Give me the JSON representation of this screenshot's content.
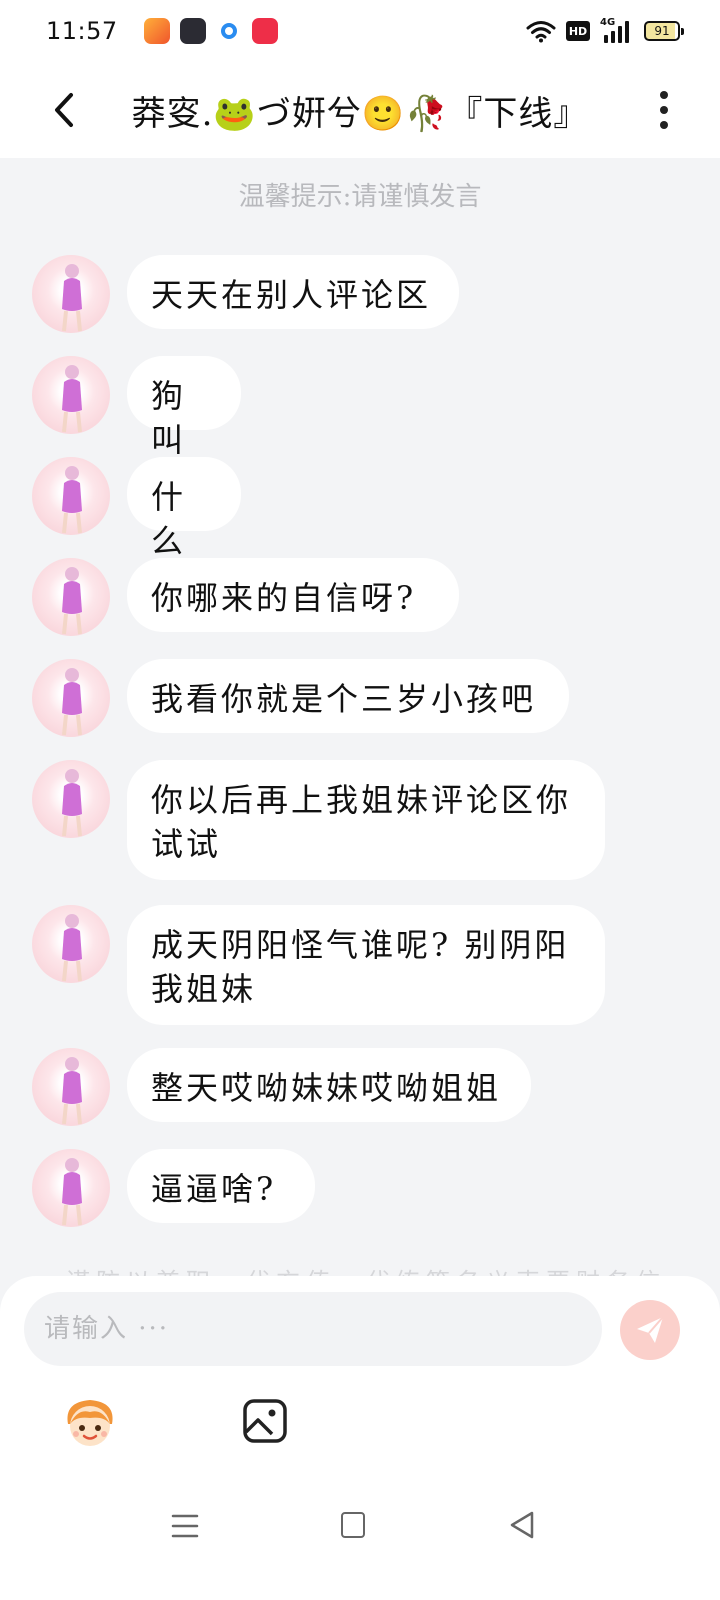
{
  "status_bar": {
    "time": "11:57",
    "network_label": "4G",
    "hd_label": "HD",
    "battery": "91",
    "notification_icons": [
      "app-icon-orange",
      "app-icon-dark",
      "app-icon-blue",
      "app-icon-red"
    ]
  },
  "header": {
    "title": "莽叜.🐸づ姸兮🙂🥀『下线』"
  },
  "tip": "温馨提示:请谨慎发言",
  "messages": [
    {
      "text": "天天在别人评论区"
    },
    {
      "text": "狗叫"
    },
    {
      "text": "什么"
    },
    {
      "text": "你哪来的自信呀?"
    },
    {
      "text": "我看你就是个三岁小孩吧"
    },
    {
      "text": "你以后再上我姐妹评论区你试试"
    },
    {
      "text": "成天阴阳怪气谁呢? 别阴阳我姐妹"
    },
    {
      "text": "整天哎呦妹妹哎呦姐姐"
    },
    {
      "text": "逼逼啥?"
    }
  ],
  "faded_note": "谨防以兼职、代充值、代练等名义索要财务信息",
  "composer": {
    "placeholder": "请输入 ···"
  },
  "colors": {
    "background": "#f3f4f6",
    "bubble": "#ffffff",
    "send_button": "#fbd0cb",
    "tip_text": "#b8b9bd"
  }
}
